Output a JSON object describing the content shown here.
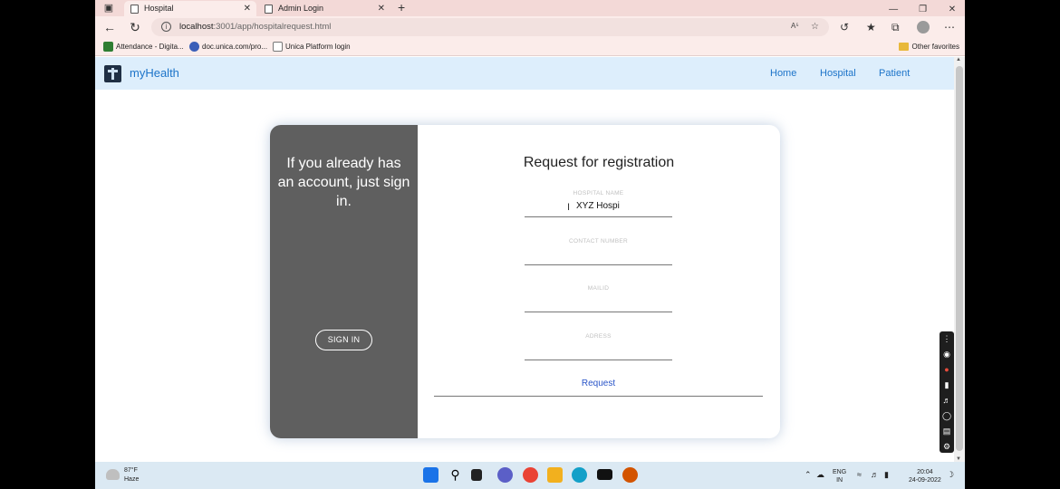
{
  "browser": {
    "tabs": [
      {
        "label": "Hospital",
        "active": true
      },
      {
        "label": "Admin Login",
        "active": false
      }
    ],
    "new_tab": "+",
    "url": {
      "host": "localhost",
      "rest": ":3001/app/hospitalrequest.html"
    },
    "bookmarks": [
      {
        "label": "Attendance - Digita...",
        "color": "#2e7d32"
      },
      {
        "label": "doc.unica.com/pro...",
        "color": "#3b5fb8"
      },
      {
        "label": "Unica Platform login",
        "color": "#777777"
      }
    ],
    "other_favorites": "Other favorites",
    "read_aloud": "A⁵"
  },
  "navbar": {
    "brand": "myHealth",
    "links": [
      "Home",
      "Hospital",
      "Patient"
    ],
    "link_color": "#1d74c9",
    "bg_color": "#ddeefc"
  },
  "card": {
    "overlay": {
      "message": "If you already has an account, just sign in.",
      "signin_label": "SIGN IN"
    },
    "form": {
      "title": "Request for registration",
      "fields": [
        {
          "label": "HOSPITAL NAME",
          "value": "XYZ Hospi"
        },
        {
          "label": "CONTACT NUMBER",
          "value": ""
        },
        {
          "label": "MAILID",
          "value": ""
        },
        {
          "label": "ADRESS",
          "value": ""
        }
      ],
      "submit_label": "Request"
    }
  },
  "taskbar": {
    "weather": {
      "temp": "87°F",
      "condition": "Haze"
    },
    "lang": {
      "line1": "ENG",
      "line2": "IN"
    },
    "time": "20:04",
    "date": "24-09-2022"
  }
}
